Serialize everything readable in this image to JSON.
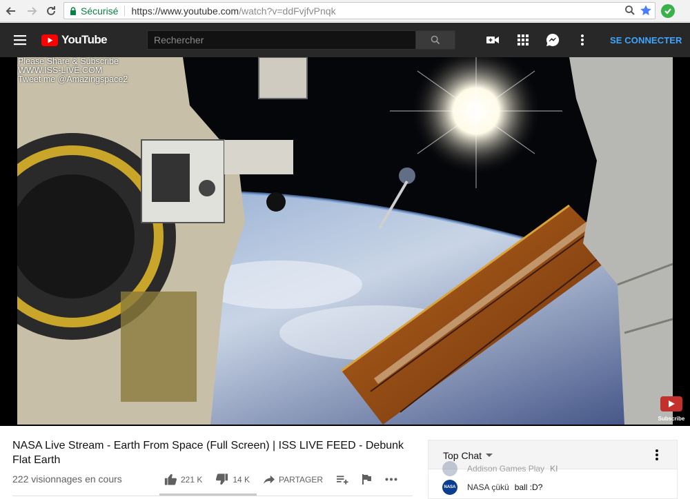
{
  "browser": {
    "secure_label": "Sécurisé",
    "url_main": "https://www.youtube.com",
    "url_path": "/watch?v=ddFvjfvPnqk"
  },
  "header": {
    "logo_text": "YouTube",
    "search_placeholder": "Rechercher",
    "signin_label": "SE CONNECTER"
  },
  "video": {
    "overlay_lines": [
      "Please Share & Subscribe",
      "WWW.ISS-LIVE.COM",
      "Tweet me @Amazingspace2"
    ],
    "subscribe_watermark": "Subscribe"
  },
  "info": {
    "title": "NASA Live Stream - Earth From Space (Full Screen) | ISS LIVE FEED - Debunk Flat Earth",
    "views": "222 visionnages en cours",
    "likes": "221 K",
    "dislikes": "14 K",
    "share_label": "PARTAGER"
  },
  "chat": {
    "header_label": "Top Chat",
    "messages": [
      {
        "author": "Addison Games Play",
        "text": "KI"
      },
      {
        "author": "NASA çükü",
        "text": "ball :D?",
        "avatar": "NASA"
      }
    ]
  },
  "colors": {
    "brand_red": "#ff0000",
    "header_bg": "#282828",
    "signin_blue": "#3ea6ff",
    "secure_green": "#0b8043"
  }
}
